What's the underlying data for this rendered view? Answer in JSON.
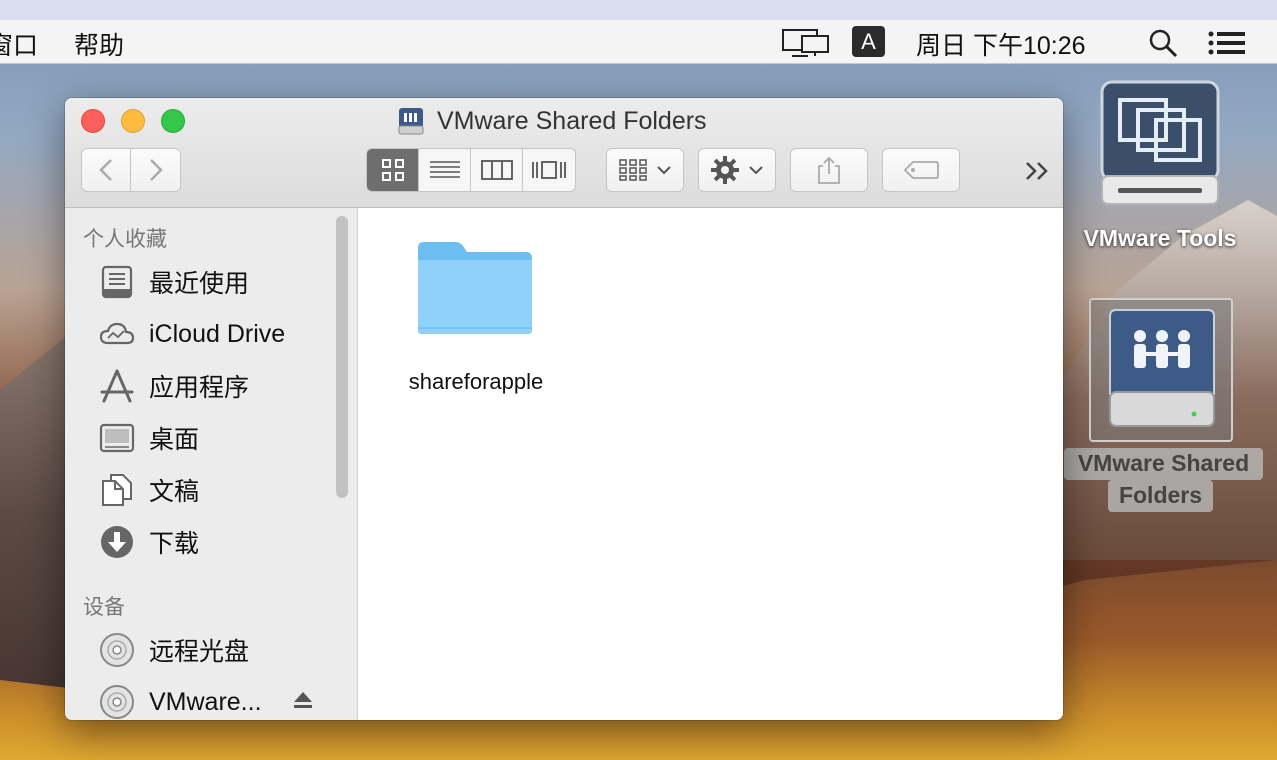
{
  "menubar": {
    "app_menu_partial": "窗口",
    "help": "帮助",
    "input_method": "A",
    "clock": "周日 下午10:26"
  },
  "window": {
    "title": "VMware Shared Folders"
  },
  "sidebar": {
    "favorites_heading": "个人收藏",
    "favorites": [
      {
        "label": "最近使用",
        "icon": "recents-icon"
      },
      {
        "label": "iCloud Drive",
        "icon": "icloud-icon"
      },
      {
        "label": "应用程序",
        "icon": "applications-icon"
      },
      {
        "label": "桌面",
        "icon": "desktop-icon"
      },
      {
        "label": "文稿",
        "icon": "documents-icon"
      },
      {
        "label": "下载",
        "icon": "downloads-icon"
      }
    ],
    "devices_heading": "设备",
    "devices": [
      {
        "label": "远程光盘",
        "icon": "disc-icon"
      },
      {
        "label": "VMware...",
        "icon": "disc-icon"
      }
    ]
  },
  "content": {
    "items": [
      {
        "name": "shareforapple",
        "type": "folder"
      }
    ]
  },
  "desktop": {
    "icons": [
      {
        "label": "VMware Tools",
        "icon": "vmware-tools-drive-icon"
      },
      {
        "label_line1": "VMware Shared",
        "label_line2": "Folders",
        "icon": "shared-folders-drive-icon",
        "selected": true
      }
    ]
  }
}
